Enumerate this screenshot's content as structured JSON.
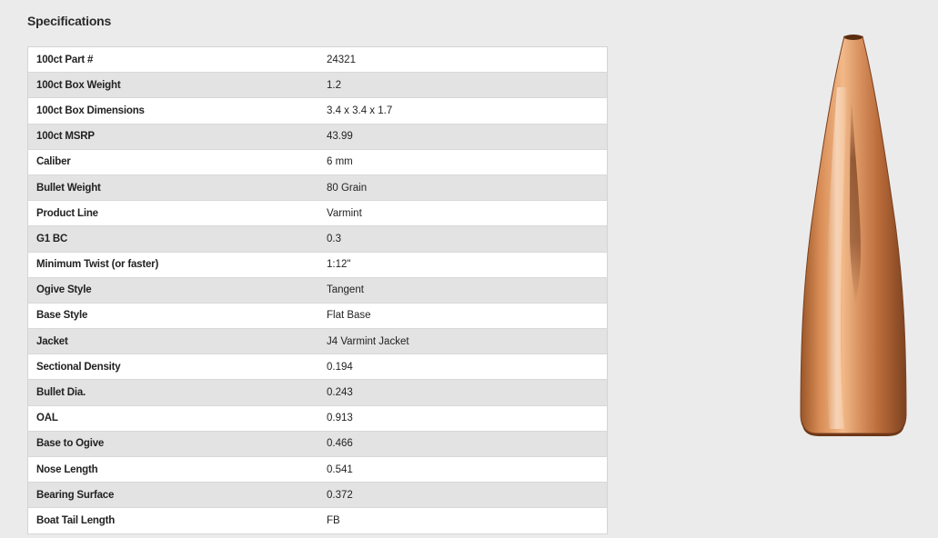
{
  "section": {
    "title": "Specifications"
  },
  "specs": [
    {
      "label": "100ct Part #",
      "value": "24321"
    },
    {
      "label": "100ct Box Weight",
      "value": "1.2"
    },
    {
      "label": "100ct Box Dimensions",
      "value": "3.4 x 3.4 x 1.7"
    },
    {
      "label": "100ct MSRP",
      "value": "43.99"
    },
    {
      "label": "Caliber",
      "value": "6 mm"
    },
    {
      "label": "Bullet Weight",
      "value": "80 Grain"
    },
    {
      "label": "Product Line",
      "value": "Varmint"
    },
    {
      "label": "G1 BC",
      "value": "0.3"
    },
    {
      "label": "Minimum Twist (or faster)",
      "value": "1:12\""
    },
    {
      "label": "Ogive Style",
      "value": "Tangent"
    },
    {
      "label": "Base Style",
      "value": "Flat Base"
    },
    {
      "label": "Jacket",
      "value": "J4 Varmint Jacket"
    },
    {
      "label": "Sectional Density",
      "value": "0.194"
    },
    {
      "label": "Bullet Dia.",
      "value": "0.243"
    },
    {
      "label": "OAL",
      "value": "0.913"
    },
    {
      "label": "Base to Ogive",
      "value": "0.466"
    },
    {
      "label": "Nose Length",
      "value": "0.541"
    },
    {
      "label": "Bearing Surface",
      "value": "0.372"
    },
    {
      "label": "Boat Tail Length",
      "value": "FB"
    }
  ],
  "product_image": {
    "icon": "bullet-product-image",
    "colors": {
      "copper_light": "#f0b07a",
      "copper_mid": "#c97a45",
      "copper_dark": "#8a4a24"
    }
  }
}
